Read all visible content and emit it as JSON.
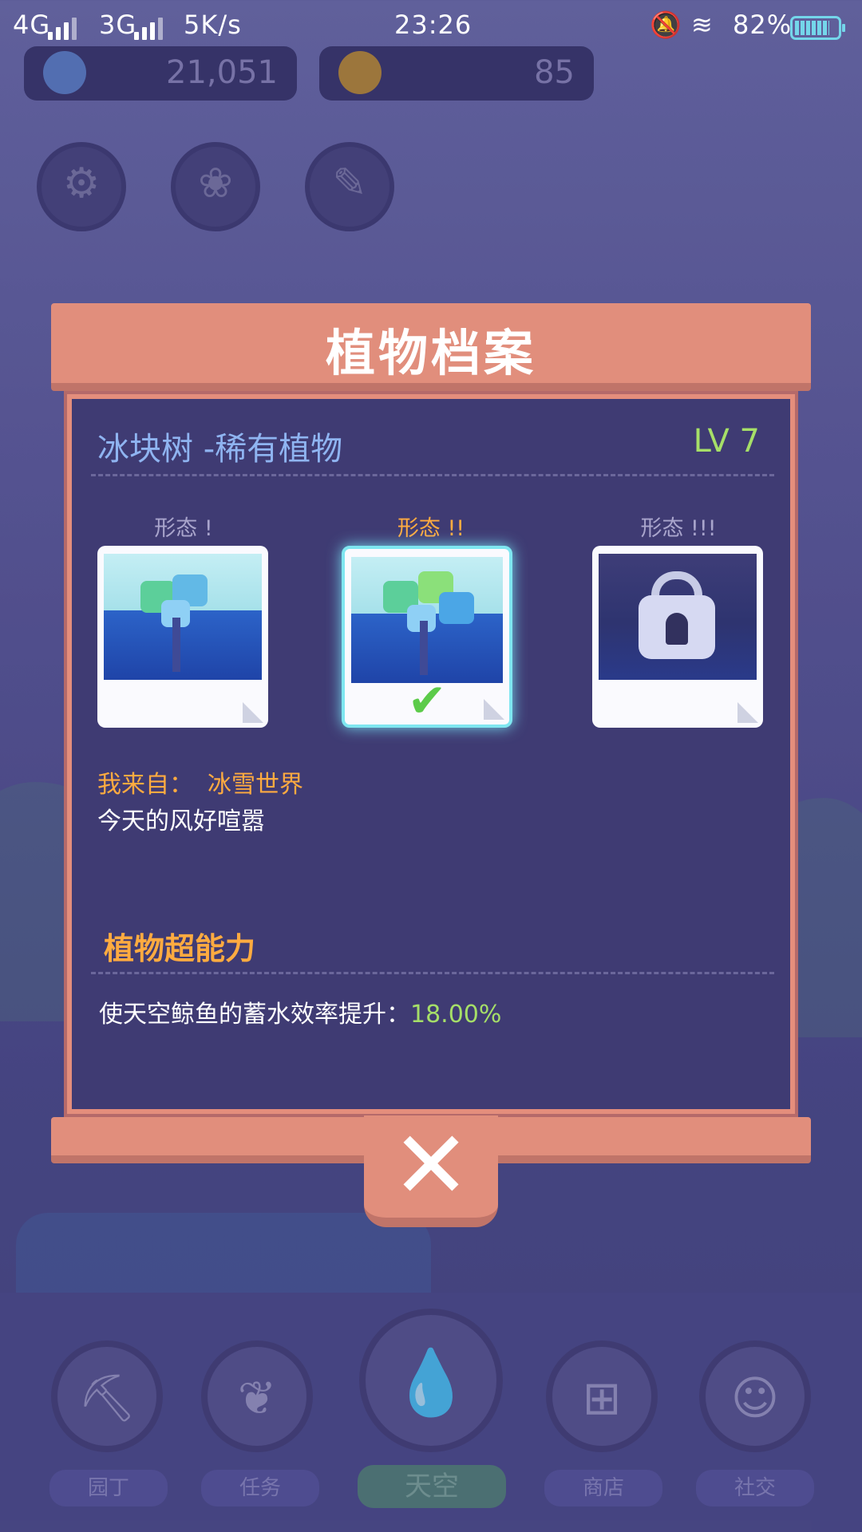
{
  "status_bar": {
    "network1": "4G",
    "network2": "3G",
    "speed": "5K/s",
    "time": "23:26",
    "battery": "82%",
    "battery_level": 0.82
  },
  "resources": {
    "water": "21,051",
    "sun": "85"
  },
  "dialog": {
    "title": "植物档案",
    "plant_name": "冰块树 -稀有植物",
    "level": "LV 7",
    "forms": [
      {
        "label": "形态 !",
        "state": "unlocked",
        "selected": false
      },
      {
        "label": "形态 !!",
        "state": "unlocked",
        "selected": true
      },
      {
        "label": "形态 !!!",
        "state": "locked",
        "selected": false
      }
    ],
    "origin_label": "我来自：",
    "origin_value": "冰雪世界",
    "quote": "今天的风好喧嚣",
    "ability_title": "植物超能力",
    "ability_text": "使天空鲸鱼的蓄水效率提升：",
    "ability_value": "18.00%",
    "close_label": "✕"
  },
  "bottom_nav": [
    {
      "label": "园丁",
      "icon": "trowel-icon"
    },
    {
      "label": "任务",
      "icon": "task-cards-icon"
    },
    {
      "label": "天空",
      "icon": "water-drop-icon"
    },
    {
      "label": "商店",
      "icon": "basket-icon"
    },
    {
      "label": "社交",
      "icon": "friends-icon"
    }
  ],
  "colors": {
    "accent_orange": "#ffab40",
    "accent_green": "#a6df68",
    "name_blue": "#8fb4f1",
    "panel": "#3f3b73",
    "frame": "#e18e7c"
  }
}
